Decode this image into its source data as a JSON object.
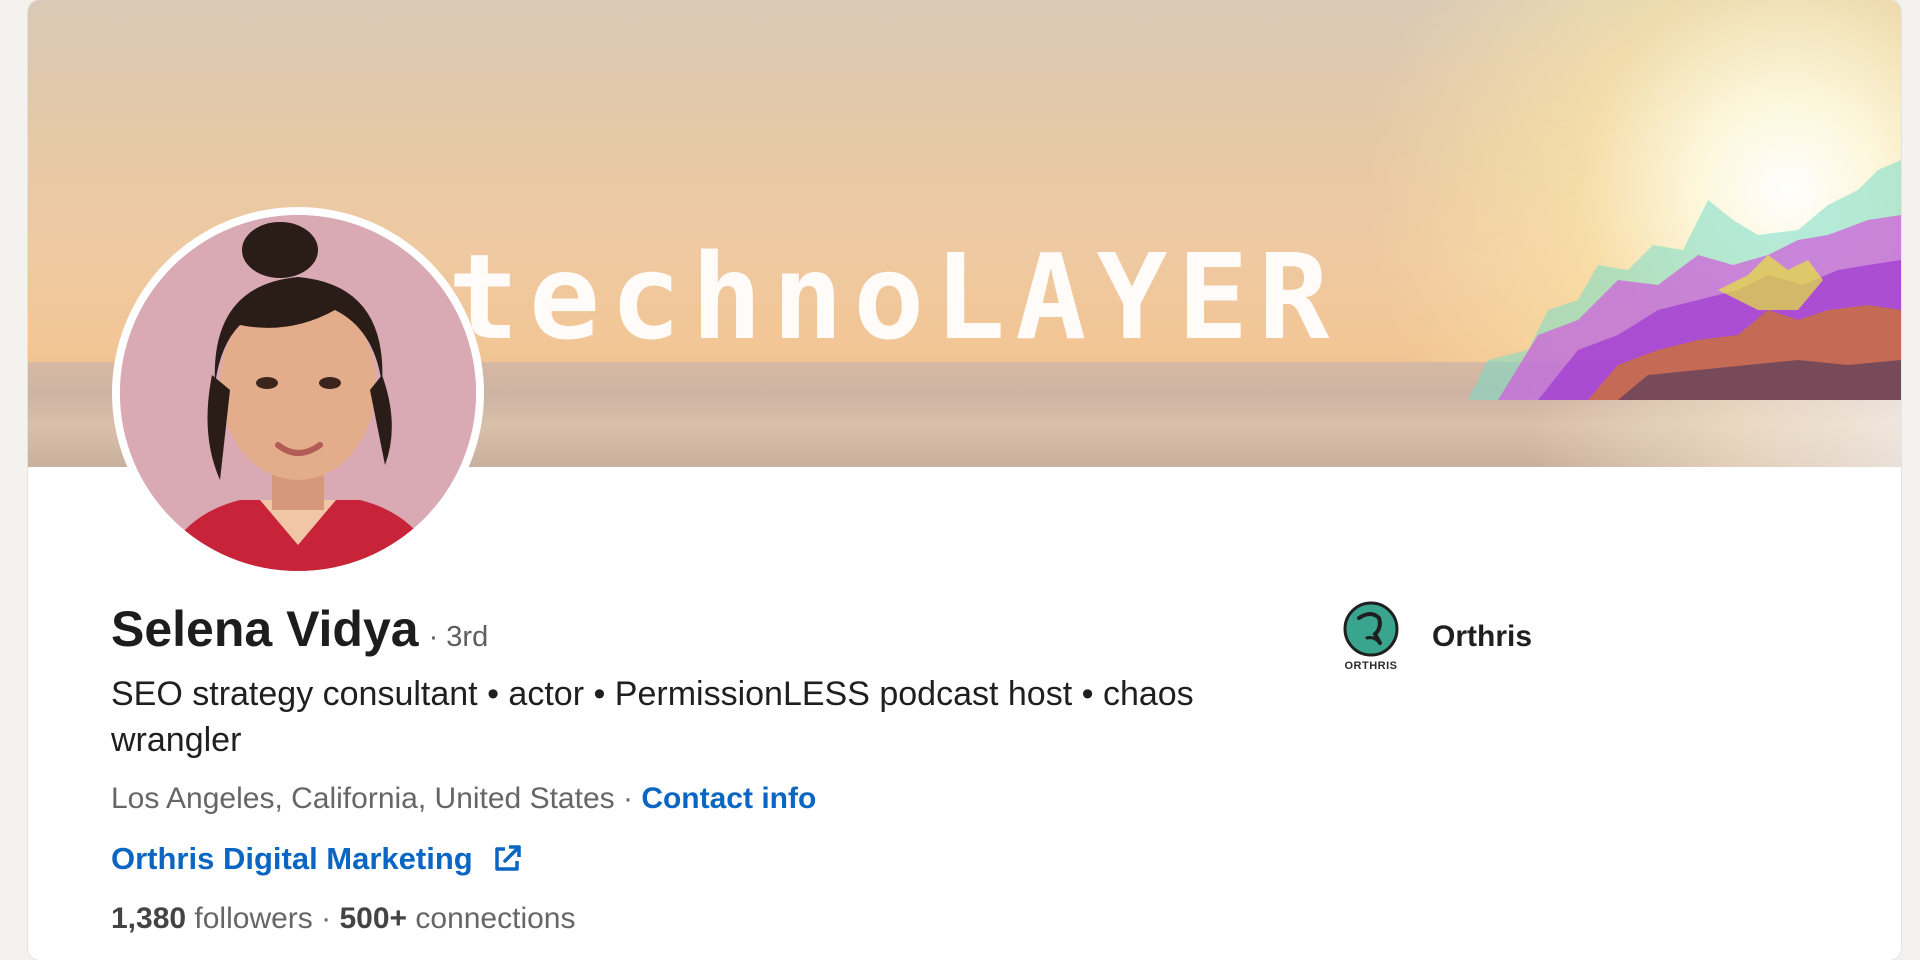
{
  "banner": {
    "wordmark": "technoLAYER"
  },
  "profile": {
    "name": "Selena Vidya",
    "degree": "· 3rd",
    "headline": "SEO strategy consultant • actor • PermissionLESS podcast host • chaos wrangler",
    "location": "Los Angeles, California, United States",
    "separator": " · ",
    "contact_info_label": "Contact info",
    "website_label": "Orthris Digital Marketing",
    "followers_count": "1,380",
    "followers_label": " followers",
    "stats_separator": "  · ",
    "connections_count": "500+",
    "connections_label": " connections"
  },
  "company": {
    "name": "Orthris",
    "logo_caption": "ORTHRIS"
  },
  "colors": {
    "link": "#0a66c2",
    "logo_teal": "#3aa58f"
  },
  "icons": {
    "website": "external-link-icon"
  }
}
